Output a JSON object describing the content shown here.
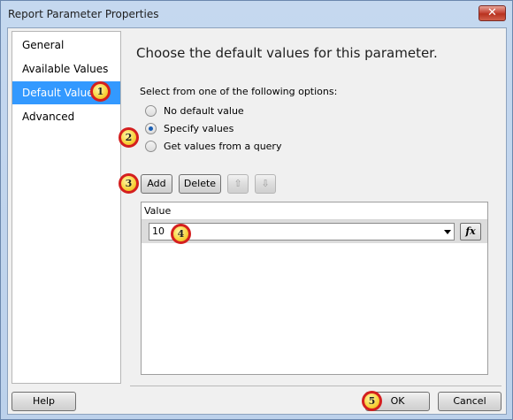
{
  "window": {
    "title": "Report Parameter Properties",
    "close_glyph": "✕"
  },
  "nav": {
    "items": [
      "General",
      "Available Values",
      "Default Values",
      "Advanced"
    ],
    "selected_index": 2
  },
  "main": {
    "heading": "Choose the default values for this parameter.",
    "instruction": "Select from one of the following options:",
    "options": [
      {
        "label": "No default value",
        "checked": false
      },
      {
        "label": "Specify values",
        "checked": true
      },
      {
        "label": "Get values from a query",
        "checked": false
      }
    ],
    "add_label": "Add",
    "delete_label": "Delete",
    "move_up_icon": "arrow-up-icon",
    "move_down_icon": "arrow-down-icon",
    "move_up_glyph": "⇧",
    "move_down_glyph": "⇩"
  },
  "grid": {
    "column_header": "Value",
    "rows": [
      {
        "value": "10"
      }
    ],
    "expression_label": "fx"
  },
  "footer": {
    "help_label": "Help",
    "ok_label": "OK",
    "cancel_label": "Cancel"
  },
  "callouts": [
    "1",
    "2",
    "3",
    "4",
    "5"
  ]
}
